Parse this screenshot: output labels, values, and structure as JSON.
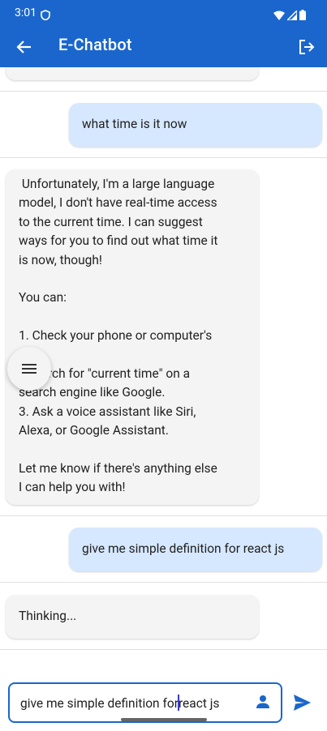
{
  "status_bar": {
    "time": "3:01"
  },
  "app_bar": {
    "title": "E-Chatbot"
  },
  "messages": [
    {
      "role": "user",
      "text": "what time is it now"
    },
    {
      "role": "bot",
      "lines": [
        " Unfortunately, I'm a large language",
        "model, I don't have real-time access",
        "to the current time. I can suggest",
        "ways for you to find out what time it",
        "is now, though!",
        "",
        "You can:",
        "",
        "1. Check your phone or computer's",
        "     k.",
        "     earch for \"current time\" on a",
        "search engine like Google.",
        "3. Ask a voice assistant like Siri,",
        "Alexa, or Google Assistant.",
        "",
        "Let me know if there's anything else",
        "I can help you with!"
      ]
    },
    {
      "role": "user",
      "text": "give me simple definition for react js"
    },
    {
      "role": "bot",
      "text": "Thinking..."
    }
  ],
  "input": {
    "value_before_caret": "give me simple definition for",
    "value_after_caret": "react js"
  },
  "icons": {
    "back": "arrow-left-icon",
    "logout": "logout-icon",
    "menu": "menu-icon",
    "person": "person-icon",
    "send": "send-icon"
  },
  "colors": {
    "app_bar": "#1a66cc",
    "user_bubble": "#d6e8ff",
    "bot_bubble": "#f4f4f4",
    "accent": "#1a66cc"
  }
}
